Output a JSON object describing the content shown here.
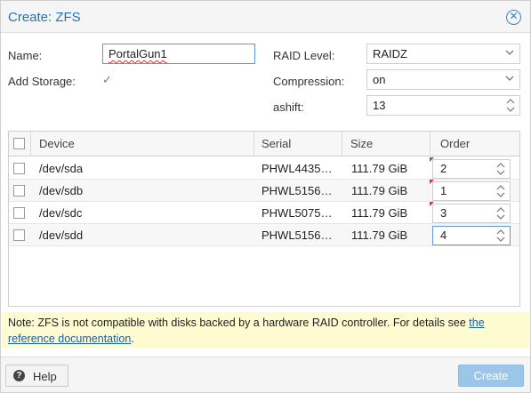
{
  "dialog": {
    "title": "Create: ZFS",
    "close_icon": "close-icon"
  },
  "form": {
    "name_label": "Name:",
    "name_value": "PortalGun1",
    "add_storage_label": "Add Storage:",
    "add_storage_checked": true,
    "raid_level_label": "RAID Level:",
    "raid_level_value": "RAIDZ",
    "compression_label": "Compression:",
    "compression_value": "on",
    "ashift_label": "ashift:",
    "ashift_value": "13"
  },
  "grid": {
    "columns": [
      "Device",
      "Serial",
      "Size",
      "Order"
    ],
    "rows": [
      {
        "device": "/dev/sda",
        "serial": "PHWL4435…",
        "size": "111.79 GiB",
        "order": "2"
      },
      {
        "device": "/dev/sdb",
        "serial": "PHWL5156…",
        "size": "111.79 GiB",
        "order": "1"
      },
      {
        "device": "/dev/sdc",
        "serial": "PHWL5075…",
        "size": "111.79 GiB",
        "order": "3"
      },
      {
        "device": "/dev/sdd",
        "serial": "PHWL5156…",
        "size": "111.79 GiB",
        "order": "4"
      }
    ]
  },
  "note": {
    "text": "Note: ZFS is not compatible with disks backed by a hardware RAID controller. For details see ",
    "link_part1": "the",
    "link_part2": "reference documentation",
    "suffix": "."
  },
  "footer": {
    "help_label": "Help",
    "create_label": "Create"
  },
  "colors": {
    "accent": "#1e73be",
    "create_disabled": "#9cc5ea",
    "note_bg": "#fffbd0",
    "dirty_marker": "#dd3333"
  }
}
